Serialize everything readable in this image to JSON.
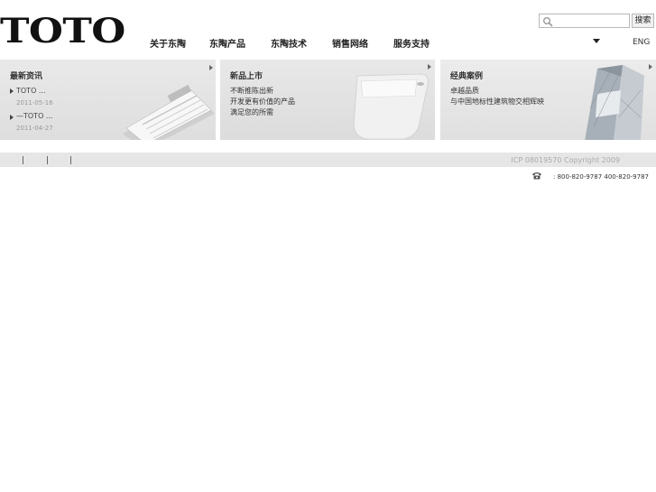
{
  "brand": {
    "logo_text": "TOTO"
  },
  "nav": [
    {
      "label": "关于东陶"
    },
    {
      "label": "东陶产品"
    },
    {
      "label": "东陶技术"
    },
    {
      "label": "销售网络"
    },
    {
      "label": "服务支持"
    }
  ],
  "search": {
    "value": "",
    "placeholder": "",
    "button_label": "搜索"
  },
  "lang": {
    "label": "ENG"
  },
  "panels": {
    "news": {
      "title": "最新资讯",
      "items": [
        {
          "title": "TOTO        ...",
          "date": "2011-05-16"
        },
        {
          "title": "        —TOTO ...",
          "date": "2011-04-27"
        }
      ]
    },
    "products": {
      "title": "新品上市",
      "lines": [
        "不断推陈出新",
        "开发更有价值的产品",
        "满足您的所需"
      ]
    },
    "cases": {
      "title": "经典案例",
      "lines": [
        "卓越品质",
        "与中国地标性建筑物交相辉映"
      ]
    }
  },
  "footer": {
    "copyright": "ICP 08019570  Copyright 2009",
    "phone": ": 800-820-9787 400-820-9787"
  },
  "icons": {
    "search": "magnifier-icon",
    "dropdown": "triangle-down-icon",
    "phone": "telephone-icon",
    "more": "triangle-right-icon"
  }
}
